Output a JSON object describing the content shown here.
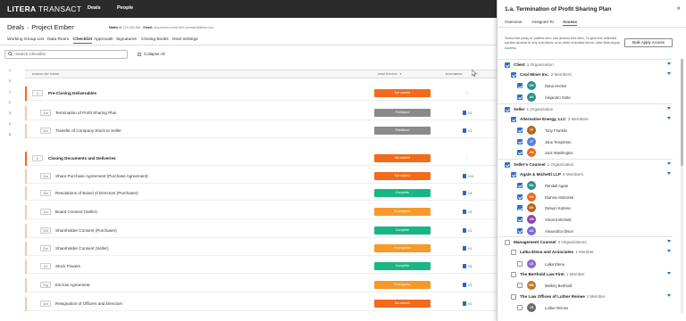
{
  "topnav": {
    "brand_bold": "LITERA",
    "brand_rest": " TRANSACT",
    "links": [
      "Deals",
      "People"
    ]
  },
  "deal": {
    "breadcrumb": "Deals",
    "name": "Project Ember",
    "matter_label": "Matter #:",
    "matter_value": "123-456-984",
    "email_label": "Email:",
    "email_value": "documents.ember.ff01.member@litera.com"
  },
  "subnav": [
    "Working Group List",
    "Data Room",
    "Checklist",
    "Approvals",
    "Signatures",
    "Closing Books",
    "Deal Settings"
  ],
  "search": {
    "placeholder": "Search Checklist"
  },
  "collapse_label": "Collapse All",
  "columns": {
    "items": "CHECKLIST ITEMS",
    "status": "ITEM STATUS",
    "document": "DOCUMENT"
  },
  "line_numbers": [
    "1",
    "0",
    "1",
    "2",
    "3",
    "4",
    "5"
  ],
  "rows": [
    {
      "num": "1",
      "title": "Pre-Closing Deliverables",
      "bold": true,
      "status": "Not started",
      "status_type": "ns",
      "doc": "-"
    },
    {
      "num": "1.a",
      "title": "Termination of Profit Sharing Plan",
      "bold": false,
      "status": "Published",
      "status_type": "pub",
      "doc": "V1"
    },
    {
      "num": "1.b",
      "title": "Transfer of Company Stock to Seller",
      "bold": false,
      "status": "Published",
      "status_type": "pub",
      "doc": "V1"
    },
    {
      "num": "2",
      "title": "Closing Documents and Deliveries",
      "bold": true,
      "status": "Not started",
      "status_type": "ns",
      "doc": "-"
    },
    {
      "num": "2.a",
      "title": "Share Purchase Agreement (Purchase Agreement)",
      "bold": false,
      "status": "Not started",
      "status_type": "ns",
      "doc": "V13"
    },
    {
      "num": "2.b",
      "title": "Resolutions of Board of Directors (Purchaser)",
      "bold": false,
      "status": "Complete",
      "status_type": "comp",
      "doc": "V4"
    },
    {
      "num": "2.c",
      "title": "Board Consent (Seller)",
      "bold": false,
      "status": "In progress",
      "status_type": "ip",
      "doc": "V4"
    },
    {
      "num": "2.d",
      "title": "Shareholder Consent (Purchaser)",
      "bold": false,
      "status": "Complete",
      "status_type": "comp",
      "doc": "V1"
    },
    {
      "num": "2.e",
      "title": "Shareholder Consent (Seller)",
      "bold": false,
      "status": "In progress",
      "status_type": "ip",
      "doc": "V1"
    },
    {
      "num": "2.f",
      "title": "Stock Powers",
      "bold": false,
      "status": "Complete",
      "status_type": "comp",
      "doc": "V4"
    },
    {
      "num": "2.g",
      "title": "Escrow Agreement",
      "bold": false,
      "status": "In progress",
      "status_type": "ip",
      "doc": "V3"
    },
    {
      "num": "2.h",
      "title": "Resignation of Officers and Directors",
      "bold": false,
      "status": "Not started",
      "status_type": "ns",
      "doc": "V1"
    }
  ],
  "panel": {
    "title": "1.a. Termination of Profit Sharing Plan",
    "close": "×",
    "tabs": [
      "Overview",
      "Assigned To",
      "Access"
    ],
    "description": "Select the party or parties who can access this item. To give the selected parties access to any sub-items or to other checklist items, click Bulk Apply Access.",
    "bulk_button": "Bulk Apply Access",
    "tree": [
      {
        "kind": "group",
        "label": "Client",
        "count": "1 Organization",
        "checked": true
      },
      {
        "kind": "org",
        "label": "Coal Miner Inc.",
        "count": "2 Members",
        "checked": true
      },
      {
        "kind": "member",
        "initials": "DH",
        "name": "Dana Hecker",
        "color": "#2e8f8f",
        "checked": true
      },
      {
        "kind": "member",
        "initials": "AS",
        "name": "Alejandro Sotto",
        "color": "#2e8f8f",
        "checked": true
      },
      {
        "kind": "group",
        "label": "Seller",
        "count": "1 Organization",
        "checked": true
      },
      {
        "kind": "org",
        "label": "Alternative Energy, LLC",
        "count": "3 Members",
        "checked": true
      },
      {
        "kind": "member",
        "initials": "TF",
        "name": "Tony Franklin",
        "color": "#b5651d",
        "checked": true
      },
      {
        "kind": "member",
        "initials": "JT",
        "name": "Jane Templeton",
        "color": "#5b7fd6",
        "checked": true
      },
      {
        "kind": "member",
        "initials": "JW",
        "name": "Jack Washington",
        "color": "#e8681e",
        "checked": true
      },
      {
        "kind": "group",
        "label": "Seller's Counsel",
        "count": "1 Organization",
        "checked": true
      },
      {
        "kind": "org",
        "label": "Agate & Michetti LLP",
        "count": "5 Members",
        "checked": true
      },
      {
        "kind": "member",
        "initials": "RA",
        "name": "Randall Agate",
        "color": "#2e8f8f",
        "checked": true
      },
      {
        "kind": "member",
        "initials": "DA",
        "name": "Dianna Antimossi",
        "color": "#e8681e",
        "checked": true
      },
      {
        "kind": "member",
        "initials": "DK",
        "name": "Delwyn Katniss",
        "color": "#b5651d",
        "checked": true
      },
      {
        "kind": "member",
        "initials": "VM",
        "name": "Vincent Michetti",
        "color": "#8e44ad",
        "checked": true
      },
      {
        "kind": "member",
        "initials": "AO",
        "name": "Alexandria Olson",
        "color": "#7a6bd6",
        "checked": true
      },
      {
        "kind": "group",
        "label": "Management Counsel",
        "count": "3 Organizations",
        "checked": false
      },
      {
        "kind": "org",
        "label": "Lalka Elena and Associates",
        "count": "1 Member",
        "checked": false
      },
      {
        "kind": "member",
        "initials": "LE",
        "name": "Lalka Elena",
        "color": "#8e6ad6",
        "checked": false
      },
      {
        "kind": "org",
        "label": "The Berthold Law Firm",
        "count": "1 Member",
        "checked": false
      },
      {
        "kind": "member",
        "initials": "MB",
        "name": "Mallory Berthold",
        "color": "#c0792c",
        "checked": false
      },
      {
        "kind": "org",
        "label": "The Law Offices of Luther Reinee",
        "count": "1 Member",
        "checked": false
      },
      {
        "kind": "member",
        "initials": "LR",
        "name": "Luther Reinee",
        "color": "#6a6a6a",
        "checked": false
      }
    ]
  },
  "colors": {
    "not_started": "#f26a1b",
    "published": "#8a8a8a",
    "complete": "#19b585",
    "in_progress": "#f59a2a",
    "accent": "#1f6fbf"
  }
}
